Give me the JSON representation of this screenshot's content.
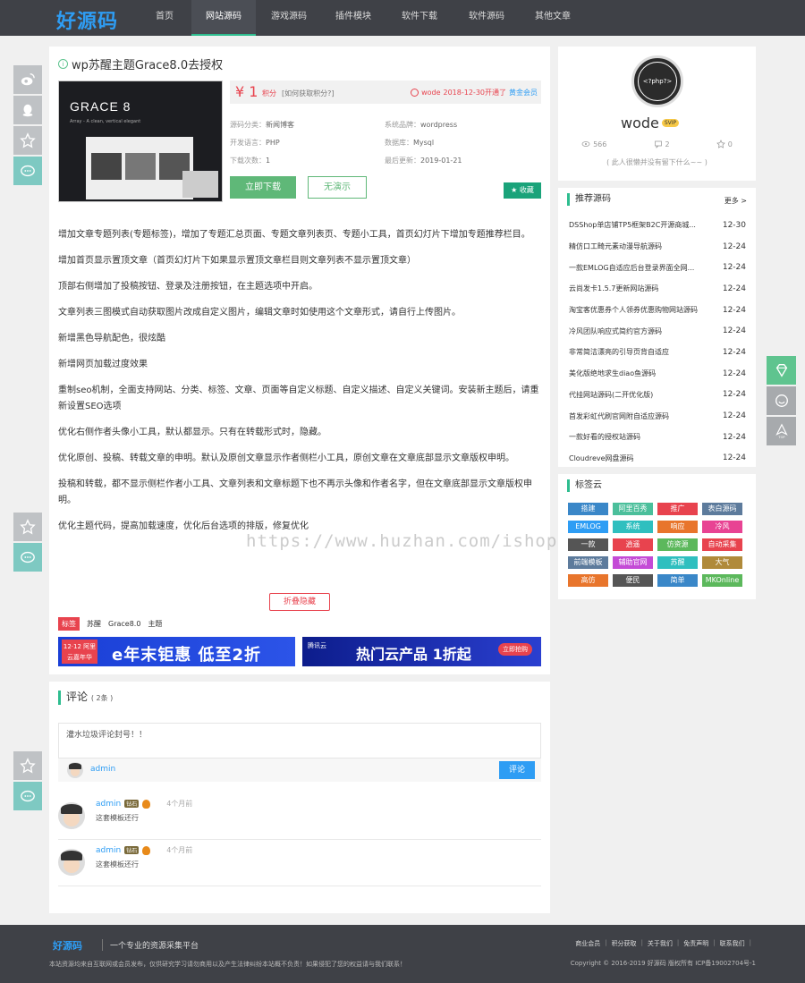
{
  "header": {
    "logo": "好源码",
    "nav": [
      {
        "label": "首页"
      },
      {
        "label": "网站源码",
        "active": true
      },
      {
        "label": "游戏源码"
      },
      {
        "label": "插件模块"
      },
      {
        "label": "软件下载"
      },
      {
        "label": "软件源码"
      },
      {
        "label": "其他文章"
      }
    ]
  },
  "post": {
    "title": "wp苏醒主题Grace8.0去授权",
    "thumb_title": "GRACE 8",
    "thumb_sub": "Array - A clean, vertical elegant",
    "price": "¥ 1",
    "price_unit": "积分",
    "price_how": "[如何获取积分?]",
    "buyer_name": "wode",
    "buyer_date": "2018-12-30开通了",
    "buyer_level": "黄金会员",
    "meta": {
      "category_label": "源码分类：",
      "category": "新闻博客",
      "system_label": "系统品牌：",
      "system": "wordpress",
      "lang_label": "开发语言：",
      "lang": "PHP",
      "db_label": "数据库：",
      "db": "Mysql",
      "downloads_label": "下载次数：",
      "downloads": "1",
      "updated_label": "最后更新：",
      "updated": "2019-01-21"
    },
    "download_btn": "立即下载",
    "demo_btn": "无演示",
    "fav_btn": "收藏",
    "paragraphs": [
      "增加文章专题列表(专题标签)，增加了专题汇总页面、专题文章列表页、专题小工具，首页幻灯片下增加专题推荐栏目。",
      "增加首页显示置顶文章（首页幻灯片下如果显示置顶文章栏目则文章列表不显示置顶文章）",
      "顶部右侧增加了投稿按钮、登录及注册按钮，在主题选项中开启。",
      "文章列表三图模式自动获取图片改成自定义图片，编辑文章时如使用这个文章形式，请自行上传图片。",
      "新增黑色导航配色，很炫酷",
      "新增网页加载过度效果",
      "重制seo机制，全面支持网站、分类、标签、文章、页面等自定义标题、自定义描述、自定义关键词。安装新主题后，请重新设置SEO选项",
      "优化右侧作者头像小工具，默认都显示。只有在转载形式时，隐藏。",
      "优化原创、投稿、转载文章的申明。默认及原创文章显示作者侧栏小工具，原创文章在文章底部显示文章版权申明。",
      "投稿和转载，都不显示侧栏作者小工具、文章列表和文章标题下也不再示头像和作者名字，但在文章底部显示文章版权申明。",
      "优化主题代码，提高加载速度，优化后台选项的排版，修复优化"
    ],
    "watermark": "https://www.huzhan.com/ishop14069",
    "collapse_btn": "折叠隐藏",
    "tags_label": "标签",
    "tags": [
      "苏醒",
      "Grace8.0",
      "主题"
    ],
    "banner1_badge": "12·12 阿里云嘉年华",
    "banner1_text": "e年末钜惠 低至2折",
    "banner2_logo": "腾讯云",
    "banner2_text": "热门云产品 1折起",
    "banner2_btn": "立即抢购"
  },
  "comments": {
    "title": "评论",
    "count": "( 2条 )",
    "placeholder": "灌水垃圾评论封号！！",
    "user": "admin",
    "submit": "评论",
    "items": [
      {
        "name": "admin",
        "badge": "钻石",
        "time": "4个月前",
        "text": "这套模板还行"
      },
      {
        "name": "admin",
        "badge": "钻石",
        "time": "4个月前",
        "text": "这套模板还行"
      }
    ]
  },
  "profile": {
    "avatar_text": "<?php?>",
    "name": "wode",
    "vip": "SVIP",
    "views": "566",
    "comments": "2",
    "stars": "0",
    "sign": "( 此人很懒并没有留下什么~~ )"
  },
  "recommend": {
    "title": "推荐源码",
    "more": "更多 >",
    "items": [
      {
        "t": "DSShop单店铺TP5框架B2C开源商城...",
        "d": "12-30"
      },
      {
        "t": "精仿口工畸元素动漫导航源码",
        "d": "12-24"
      },
      {
        "t": "一款EMLOG自适应后台登录界面全网...",
        "d": "12-24"
      },
      {
        "t": "云尚发卡1.5.7更新网站源码",
        "d": "12-24"
      },
      {
        "t": "淘宝客优惠券个人领券优惠购物网站源码",
        "d": "12-24"
      },
      {
        "t": "冷风团队响应式简约官方源码",
        "d": "12-24"
      },
      {
        "t": "非常简洁漂亮的引导页背自适应",
        "d": "12-24"
      },
      {
        "t": "美化版绝地求生diao鱼源码",
        "d": "12-24"
      },
      {
        "t": "代挂网站源码(二开优化版)",
        "d": "12-24"
      },
      {
        "t": "首发彩虹代刷官网附自适应源码",
        "d": "12-24"
      },
      {
        "t": "一款好看的授权站源码",
        "d": "12-24"
      },
      {
        "t": "Cloudreve网盘源码",
        "d": "12-24"
      }
    ]
  },
  "tagcloud": {
    "title": "标签云",
    "tags": [
      {
        "t": "搭建",
        "c": "#3a87c8"
      },
      {
        "t": "阿里百秀",
        "c": "#4bbf9b"
      },
      {
        "t": "推广",
        "c": "#e8434e"
      },
      {
        "t": "表白源码",
        "c": "#5d7b9c"
      },
      {
        "t": "EMLOG",
        "c": "#2e9df4"
      },
      {
        "t": "系统",
        "c": "#2fbfbf"
      },
      {
        "t": "响应",
        "c": "#e8752c"
      },
      {
        "t": "冷风",
        "c": "#e84393"
      },
      {
        "t": "一款",
        "c": "#555555"
      },
      {
        "t": "逍遥",
        "c": "#e8434e"
      },
      {
        "t": "仿资源",
        "c": "#5cb85c"
      },
      {
        "t": "自动采集",
        "c": "#e8434e"
      },
      {
        "t": "前端模板",
        "c": "#5d7b9c"
      },
      {
        "t": "辅助官网",
        "c": "#c44bd6"
      },
      {
        "t": "苏醒",
        "c": "#2fbfbf"
      },
      {
        "t": "大气",
        "c": "#b08a3a"
      },
      {
        "t": "高仿",
        "c": "#e8752c"
      },
      {
        "t": "便民",
        "c": "#555555"
      },
      {
        "t": "简单",
        "c": "#3a87c8"
      },
      {
        "t": "MKOnline",
        "c": "#5cb85c"
      }
    ]
  },
  "footer": {
    "logo": "好源码",
    "slogan": "一个专业的资源采集平台",
    "disclaimer": "本站资源均来自互联网或会员发布，仅供研究学习请勿商用以及产生法律纠纷本站概不负责！如果侵犯了您的权益请与我们联系！",
    "links": [
      "商业会员",
      "积分获取",
      "关于我们",
      "免责声明",
      "联系我们"
    ],
    "copyright": "Copyright © 2016-2019 好源码 版权所有 ICP备19002704号-1"
  }
}
